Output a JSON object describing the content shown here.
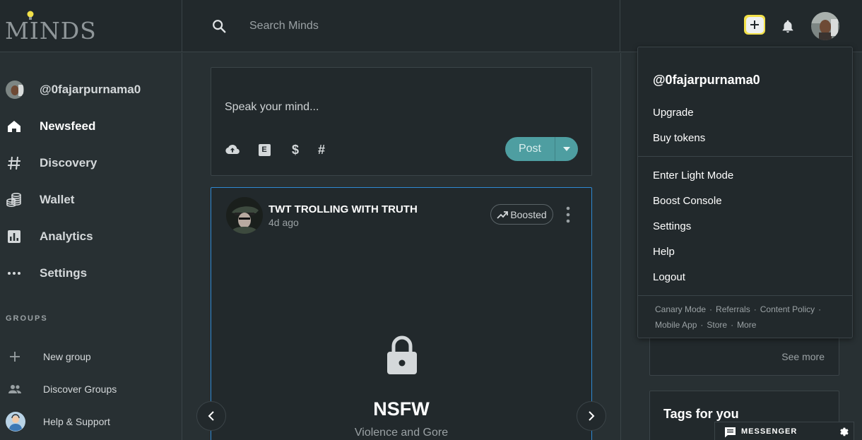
{
  "app": {
    "logo_text": "MINDS",
    "accent_color": "#4e9ea1",
    "boost_border_color": "#2f8ad4"
  },
  "topbar": {
    "search_placeholder": "Search Minds",
    "icons": [
      "search-icon",
      "compose-icon",
      "notifications-bell-icon",
      "user-avatar"
    ]
  },
  "sidebar": {
    "user": {
      "handle": "@0fajarpurnama0"
    },
    "items": [
      {
        "label": "Newsfeed",
        "icon": "home-icon",
        "active": true
      },
      {
        "label": "Discovery",
        "icon": "hash-icon"
      },
      {
        "label": "Wallet",
        "icon": "coins-icon"
      },
      {
        "label": "Analytics",
        "icon": "chart-icon"
      },
      {
        "label": "Settings",
        "icon": "more-dots-icon"
      }
    ],
    "groups_title": "GROUPS",
    "groups": [
      {
        "label": "New group",
        "icon": "plus-icon"
      },
      {
        "label": "Discover Groups",
        "icon": "people-icon"
      },
      {
        "label": "Help & Support",
        "icon": "support-avatar"
      }
    ]
  },
  "composer": {
    "placeholder": "Speak your mind...",
    "tools": [
      "upload-icon",
      "nsfw-e-icon",
      "dollar-icon",
      "hashtag-icon"
    ],
    "tool_labels": {
      "nsfw": "E",
      "dollar": "$",
      "hashtag": "#"
    },
    "post_label": "Post"
  },
  "activity": {
    "owner": "TWT TROLLING WITH TRUTH",
    "time": "4d ago",
    "badge": "Boosted",
    "nsfw_title": "NSFW",
    "nsfw_reason": "Violence and Gore"
  },
  "right": {
    "see_more": "See more",
    "tags_title": "Tags for you"
  },
  "dropdown": {
    "handle": "@0fajarpurnama0",
    "group1": [
      "Upgrade",
      "Buy tokens"
    ],
    "group2": [
      "Enter Light Mode",
      "Boost Console",
      "Settings",
      "Help",
      "Logout"
    ],
    "footer_line1": [
      "Canary Mode",
      "Referrals",
      "Content Policy"
    ],
    "footer_line2": [
      "Mobile App",
      "Store",
      "More"
    ]
  },
  "messenger": {
    "label": "MESSENGER"
  }
}
